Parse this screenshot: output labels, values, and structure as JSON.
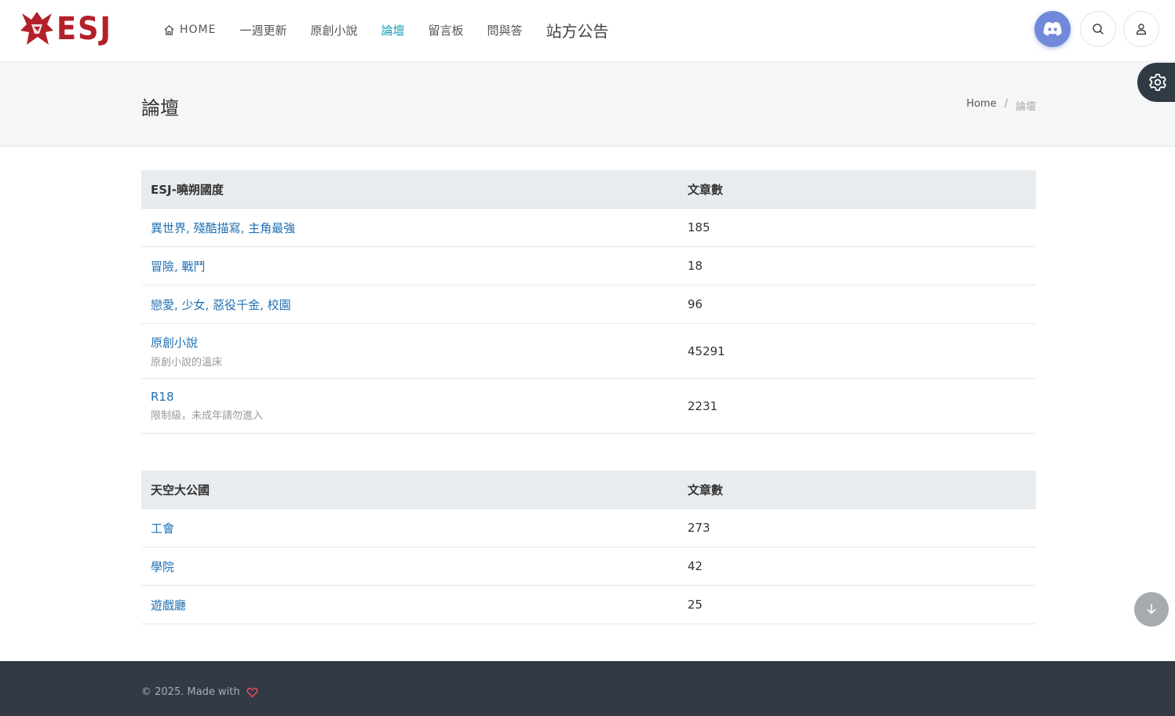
{
  "header": {
    "logo_text": "ESJ",
    "nav": [
      {
        "label": "HOME",
        "icon": "home-icon"
      },
      {
        "label": "一週更新"
      },
      {
        "label": "原創小說"
      },
      {
        "label": "論壇",
        "active": true
      },
      {
        "label": "留言板"
      },
      {
        "label": "問與答"
      },
      {
        "label": "站方公告"
      }
    ],
    "icons": [
      "discord-icon",
      "search-icon",
      "user-icon"
    ]
  },
  "page": {
    "title": "論壇",
    "breadcrumb": {
      "home": "Home",
      "separator": "/",
      "current": "論壇"
    }
  },
  "tables": [
    {
      "header": {
        "name": "ESJ-曉朔國度",
        "count": "文章數"
      },
      "rows": [
        {
          "name": "異世界, 殘酷描寫, 主角最強",
          "count": "185"
        },
        {
          "name": "冒險, 戰鬥",
          "count": "18"
        },
        {
          "name": "戀愛, 少女, 惡役千金, 校園",
          "count": "96"
        },
        {
          "name": "原創小說",
          "desc": "原創小說的溫床",
          "count": "45291"
        },
        {
          "name": "R18",
          "desc": "限制級，未成年請勿進入",
          "count": "2231"
        }
      ]
    },
    {
      "header": {
        "name": "天空大公國",
        "count": "文章數"
      },
      "rows": [
        {
          "name": "工會",
          "count": "273"
        },
        {
          "name": "學院",
          "count": "42"
        },
        {
          "name": "遊戲廳",
          "count": "25"
        }
      ]
    }
  ],
  "footer": {
    "text": "© 2025. Made with"
  },
  "colors": {
    "accent": "#17a2b8",
    "link": "#1f6fb2",
    "brand": "#b3202a",
    "discord": "#7289da",
    "footer_bg": "#343a45"
  }
}
